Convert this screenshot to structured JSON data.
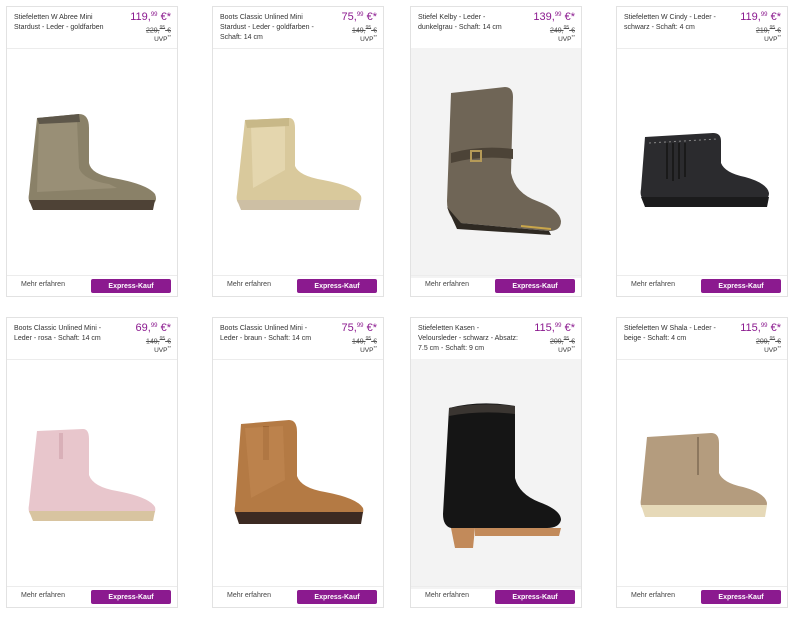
{
  "common": {
    "more_label": "Mehr erfahren",
    "buy_label": "Express-Kauf",
    "price_suffix": "€*",
    "old_suffix": "€",
    "uvp_label": "UVP",
    "uvp_marker": "**",
    "accent": "#8b1a8f"
  },
  "products": [
    {
      "name": "Stiefeletten W Abree Mini Stardust - Leder - goldfarben",
      "price_int": "119,",
      "price_dec": "99",
      "old_int": "229,",
      "old_dec": "95"
    },
    {
      "name": "Boots Classic Unlined Mini Stardust - Leder - goldfarben - Schaft: 14 cm",
      "price_int": "75,",
      "price_dec": "99",
      "old_int": "149,",
      "old_dec": "95"
    },
    {
      "name": "Stiefel Kelby - Leder - dunkelgrau - Schaft: 14 cm",
      "price_int": "139,",
      "price_dec": "99",
      "old_int": "249,",
      "old_dec": "95"
    },
    {
      "name": "Stiefeletten W Cindy - Leder - schwarz - Schaft: 4 cm",
      "price_int": "119,",
      "price_dec": "99",
      "old_int": "219,",
      "old_dec": "95"
    },
    {
      "name": "Boots Classic Unlined Mini - Leder - rosa - Schaft: 14 cm",
      "price_int": "69,",
      "price_dec": "99",
      "old_int": "149,",
      "old_dec": "95"
    },
    {
      "name": "Boots Classic Unlined Mini - Leder - braun - Schaft: 14 cm",
      "price_int": "75,",
      "price_dec": "99",
      "old_int": "149,",
      "old_dec": "95"
    },
    {
      "name": "Stiefeletten Kasen - Veloursleder - schwarz - Absatz: 7.5 cm - Schaft: 9 cm",
      "price_int": "115,",
      "price_dec": "99",
      "old_int": "209,",
      "old_dec": "95"
    },
    {
      "name": "Stiefeletten W Shala - Leder - beige - Schaft: 4 cm",
      "price_int": "115,",
      "price_dec": "99",
      "old_int": "209,",
      "old_dec": "95"
    }
  ]
}
